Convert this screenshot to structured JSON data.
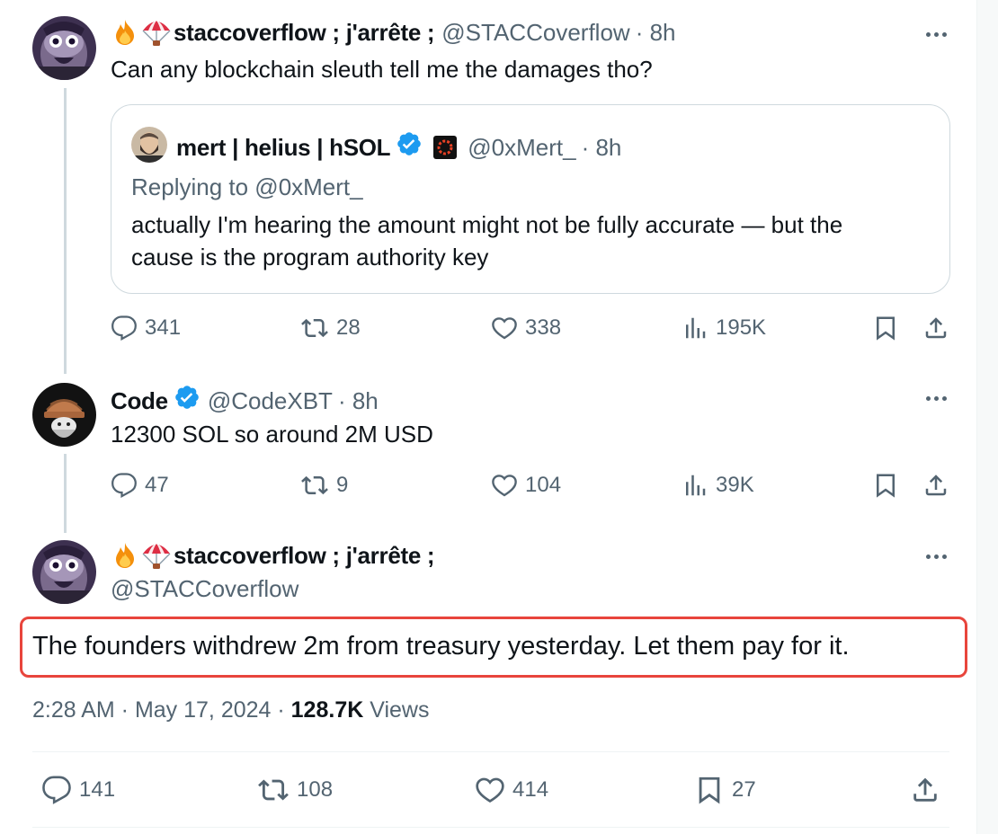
{
  "tweets": [
    {
      "emojis": [
        "fire",
        "parachute"
      ],
      "display_name": "staccoverflow ; j'arrête ;",
      "handle": "@STACCoverflow",
      "time": "· 8h",
      "text": "Can any blockchain sleuth tell me the damages tho?",
      "quote": {
        "display_name": "mert | helius | hSOL",
        "handle": "@0xMert_",
        "time": "· 8h",
        "replying_to": "Replying to @0xMert_",
        "text_line1": "actually I'm hearing the amount might not be fully accurate — but the",
        "text_line2": "cause is the program authority key"
      },
      "stats": {
        "replies": "341",
        "reposts": "28",
        "likes": "338",
        "views": "195K"
      }
    },
    {
      "display_name": "Code",
      "handle": "@CodeXBT",
      "time": "· 8h",
      "text": "12300 SOL so around 2M USD",
      "stats": {
        "replies": "47",
        "reposts": "9",
        "likes": "104",
        "views": "39K"
      }
    }
  ],
  "main": {
    "emojis": [
      "fire",
      "parachute"
    ],
    "display_name": "staccoverflow ; j'arrête ;",
    "handle": "@STACCoverflow",
    "text": "The founders withdrew 2m from treasury yesterday. Let them pay for it.",
    "timestamp": "2:28 AM · May 17, 2024 ·",
    "views_count": "128.7K",
    "views_label": "Views",
    "stats": {
      "replies": "141",
      "reposts": "108",
      "likes": "414",
      "bookmarks": "27"
    }
  },
  "colors": {
    "text": "#0f1419",
    "muted": "#536471",
    "verified": "#1d9bf0",
    "highlight": "#e8453c",
    "border": "#cfd9de"
  }
}
